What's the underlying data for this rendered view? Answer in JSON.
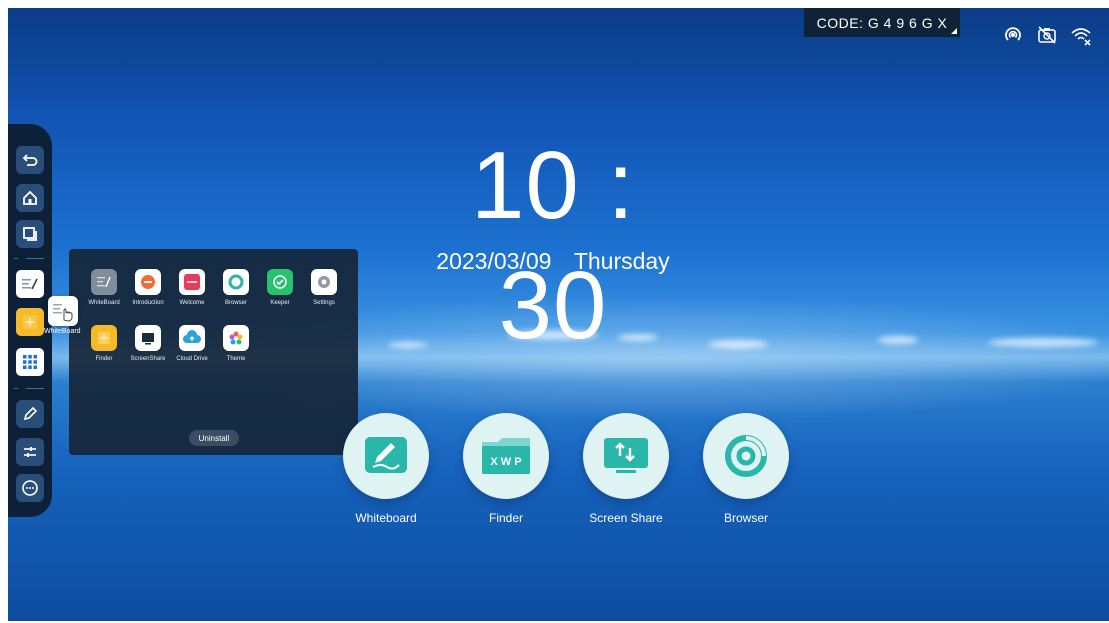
{
  "status_bar": {
    "code_label": "CODE: G 4 9 6 G X",
    "icons": [
      "hotspot-icon",
      "camera-off-icon",
      "wifi-off-icon"
    ]
  },
  "clock": {
    "time": "10 : 30",
    "date": "2023/03/09",
    "weekday": "Thursday"
  },
  "sidebar": {
    "items": [
      "back-icon",
      "home-icon",
      "multitask-icon",
      "whiteboard-app",
      "finder-app",
      "apps-grid-icon",
      "pen-icon",
      "sliders-icon",
      "more-icon"
    ]
  },
  "drag": {
    "label": "WhiteBoard"
  },
  "drawer": {
    "apps": [
      {
        "label": "WhiteBoard",
        "color": "#7f8c99"
      },
      {
        "label": "Introduction",
        "color": "#ffffff"
      },
      {
        "label": "Welcome",
        "color": "#e83a5a"
      },
      {
        "label": "Browser",
        "color": "#ffffff"
      },
      {
        "label": "Keeper",
        "color": "#2bc06e"
      },
      {
        "label": "Settings",
        "color": "#ffffff"
      },
      {
        "label": "Finder",
        "color": "#f6b92a"
      },
      {
        "label": "ScreenShare",
        "color": "#ffffff"
      },
      {
        "label": "Cloud Drive",
        "color": "#ffffff"
      },
      {
        "label": "Theme",
        "color": "#ffffff"
      }
    ],
    "uninstall_label": "Uninstall"
  },
  "dock": {
    "items": [
      {
        "label": "Whiteboard"
      },
      {
        "label": "Finder",
        "icon_text": "X W P"
      },
      {
        "label": "Screen Share"
      },
      {
        "label": "Browser"
      }
    ]
  },
  "colors": {
    "accent_teal": "#2ab7a9",
    "sidebar_bg": "#0c2138",
    "drawer_bg": "#162638"
  }
}
